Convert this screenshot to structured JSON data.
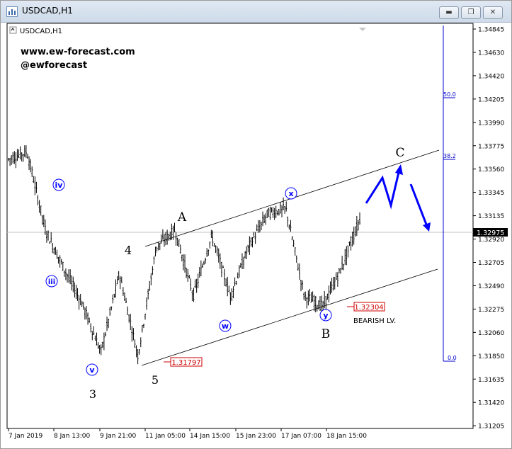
{
  "window": {
    "title": "USDCAD,H1",
    "minimize_icon": "minimize-icon",
    "restore_icon": "restore-icon",
    "close_icon": "close-icon"
  },
  "chart_label": "USDCAD,H1",
  "watermark": {
    "website": "www.ew-forecast.com",
    "handle": "@ewforecast"
  },
  "price_scale": [
    "1.34845",
    "1.34630",
    "1.34420",
    "1.34205",
    "1.33990",
    "1.33775",
    "1.33560",
    "1.33345",
    "1.33135",
    "1.32920",
    "1.32705",
    "1.32490",
    "1.32275",
    "1.32060",
    "1.31850",
    "1.31635",
    "1.31420",
    "1.31205"
  ],
  "current_price": "1.32975",
  "time_scale": [
    "7 Jan 2019",
    "8 Jan 13:00",
    "9 Jan 21:00",
    "11 Jan 05:00",
    "14 Jan 15:00",
    "15 Jan 23:00",
    "17 Jan 07:00",
    "18 Jan 15:00"
  ],
  "fib_levels": [
    "50.0",
    "38.2",
    "0.0"
  ],
  "wave_labels": {
    "iv": "iv",
    "iii": "iii",
    "v": "v",
    "three": "3",
    "four": "4",
    "five": "5",
    "A": "A",
    "w": "w",
    "x": "x",
    "y": "y",
    "B": "B",
    "C": "C"
  },
  "price_boxes": {
    "low_5": "1.31797",
    "low_B": "1.32304"
  },
  "annotation": "BEARISH LV.",
  "colors": {
    "accent": "#0000ff",
    "candles": "#000000",
    "price_box": "#cc0000",
    "current_price_bg": "#000000"
  },
  "chart_data": {
    "type": "line",
    "title": "USDCAD,H1",
    "ylim": [
      1.3112,
      1.3489
    ],
    "x": [
      "7 Jan 2019",
      "7 Jan 12:00",
      "8 Jan 00:00",
      "8 Jan 13:00",
      "9 Jan 08:00",
      "9 Jan 21:00",
      "10 Jan 12:00",
      "11 Jan 05:00",
      "11 Jan 14:00",
      "14 Jan 08:00",
      "14 Jan 15:00",
      "15 Jan 08:00",
      "15 Jan 23:00",
      "16 Jan 12:00",
      "17 Jan 00:00",
      "17 Jan 07:00",
      "17 Jan 20:00",
      "18 Jan 09:00",
      "18 Jan 15:00",
      "18 Jan 22:00"
    ],
    "series": [
      {
        "values": [
          1.3365,
          1.3372,
          1.33,
          1.3265,
          1.3232,
          1.3188,
          1.326,
          1.3185,
          1.3285,
          1.33,
          1.324,
          1.3295,
          1.324,
          1.3285,
          1.3315,
          1.332,
          1.324,
          1.323,
          1.3265,
          1.331
        ]
      }
    ]
  }
}
